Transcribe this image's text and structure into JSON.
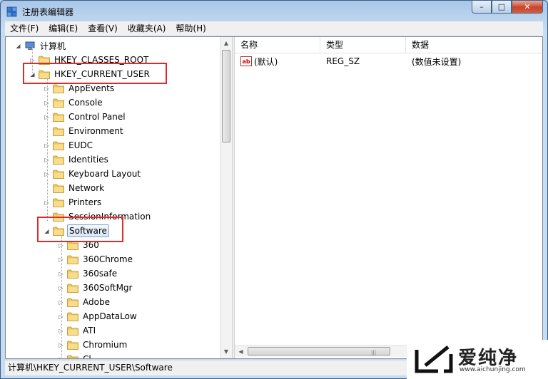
{
  "window": {
    "title": "注册表编辑器",
    "minimize": "–",
    "maximize": "□",
    "close": "✕"
  },
  "menu": [
    "文件(F)",
    "编辑(E)",
    "查看(V)",
    "收藏夹(A)",
    "帮助(H)"
  ],
  "tree": {
    "root": "计算机",
    "hives": [
      {
        "label": "HKEY_CLASSES_ROOT",
        "expanded": false
      },
      {
        "label": "HKEY_CURRENT_USER",
        "expanded": true
      }
    ],
    "hkcu_children": [
      {
        "label": "AppEvents",
        "has_children": true
      },
      {
        "label": "Console",
        "has_children": true
      },
      {
        "label": "Control Panel",
        "has_children": true
      },
      {
        "label": "Environment",
        "has_children": false
      },
      {
        "label": "EUDC",
        "has_children": true
      },
      {
        "label": "Identities",
        "has_children": true
      },
      {
        "label": "Keyboard Layout",
        "has_children": true
      },
      {
        "label": "Network",
        "has_children": false
      },
      {
        "label": "Printers",
        "has_children": true
      },
      {
        "label": "SessionInformation",
        "has_children": false
      },
      {
        "label": "Software",
        "has_children": true,
        "expanded": true,
        "selected": true
      }
    ],
    "software_children": [
      {
        "label": "360",
        "has_children": true
      },
      {
        "label": "360Chrome",
        "has_children": true
      },
      {
        "label": "360safe",
        "has_children": true
      },
      {
        "label": "360SoftMgr",
        "has_children": true
      },
      {
        "label": "Adobe",
        "has_children": true
      },
      {
        "label": "AppDataLow",
        "has_children": true
      },
      {
        "label": "ATI",
        "has_children": true
      },
      {
        "label": "Chromium",
        "has_children": true
      },
      {
        "label": "Cl",
        "has_children": true
      }
    ]
  },
  "list": {
    "columns": [
      "名称",
      "类型",
      "数据"
    ],
    "rows": [
      {
        "name": "(默认)",
        "type": "REG_SZ",
        "data": "(数值未设置)",
        "icon": "string-value-icon"
      }
    ]
  },
  "status": "计算机\\HKEY_CURRENT_USER\\Software",
  "watermark": {
    "brand": "爱纯净",
    "url": "www.aichunjing.com"
  },
  "colors": {
    "highlight": "#e02a2a",
    "folder": "#f0c85a",
    "selection": "#d9e7f8"
  }
}
